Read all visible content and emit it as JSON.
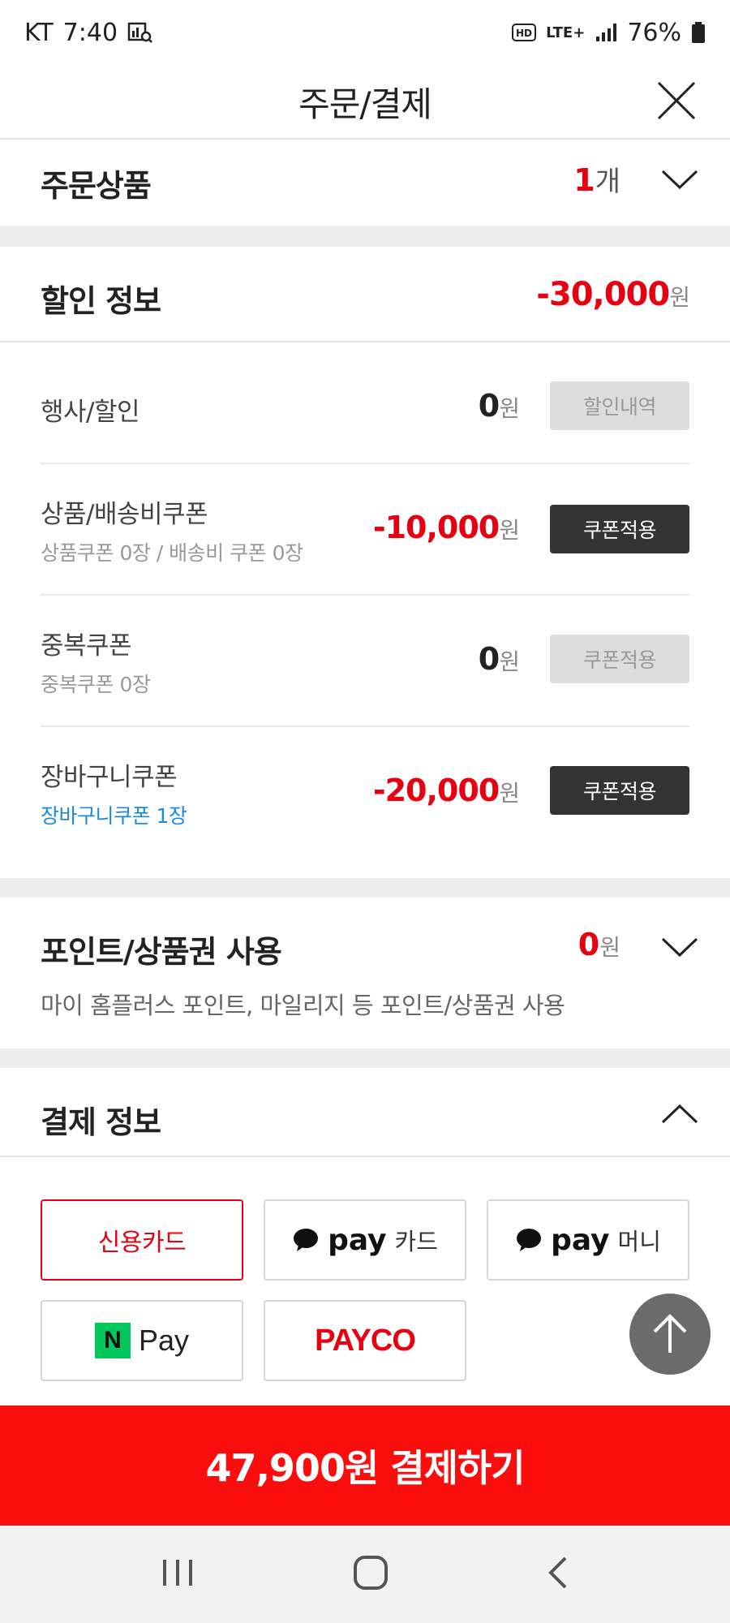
{
  "status_bar": {
    "carrier": "KT",
    "time": "7:40",
    "network": "LTE+",
    "battery": "76%"
  },
  "header": {
    "title": "주문/결제"
  },
  "order_items": {
    "title": "주문상품",
    "count": "1",
    "count_unit": "개"
  },
  "discount": {
    "title": "할인 정보",
    "total": "-30,000",
    "won": "원",
    "rows": [
      {
        "label": "행사/할인",
        "sub": "",
        "amount": "0",
        "won": "원",
        "button": "할인내역",
        "button_enabled": false
      },
      {
        "label": "상품/배송비쿠폰",
        "sub": "상품쿠폰 0장 / 배송비 쿠폰 0장",
        "amount": "-10,000",
        "won": "원",
        "button": "쿠폰적용",
        "button_enabled": true
      },
      {
        "label": "중복쿠폰",
        "sub": "중복쿠폰 0장",
        "amount": "0",
        "won": "원",
        "button": "쿠폰적용",
        "button_enabled": false
      },
      {
        "label": "장바구니쿠폰",
        "sub": "장바구니쿠폰 1장",
        "amount": "-20,000",
        "won": "원",
        "button": "쿠폰적용",
        "button_enabled": true
      }
    ]
  },
  "points": {
    "title": "포인트/상품권 사용",
    "amount": "0",
    "won": "원",
    "description": "마이 홈플러스 포인트, 마일리지 등 포인트/상품권 사용"
  },
  "payment": {
    "title": "결제 정보",
    "methods": {
      "credit_card": "신용카드",
      "kakaopay_card_brand": "pay",
      "kakaopay_card_label": "카드",
      "kakaopay_money_brand": "pay",
      "kakaopay_money_label": "머니",
      "naverpay_logo": "N",
      "naverpay_label": "Pay",
      "payco": "PAYCO"
    },
    "selected": "신용카드"
  },
  "checkout": {
    "label": "47,900원 결제하기"
  },
  "colors": {
    "accent": "#e60012",
    "checkout_bg": "#f90d0d",
    "blue_text": "#1b8bd6",
    "dark_button": "#333333",
    "naver_green": "#03c75a"
  }
}
